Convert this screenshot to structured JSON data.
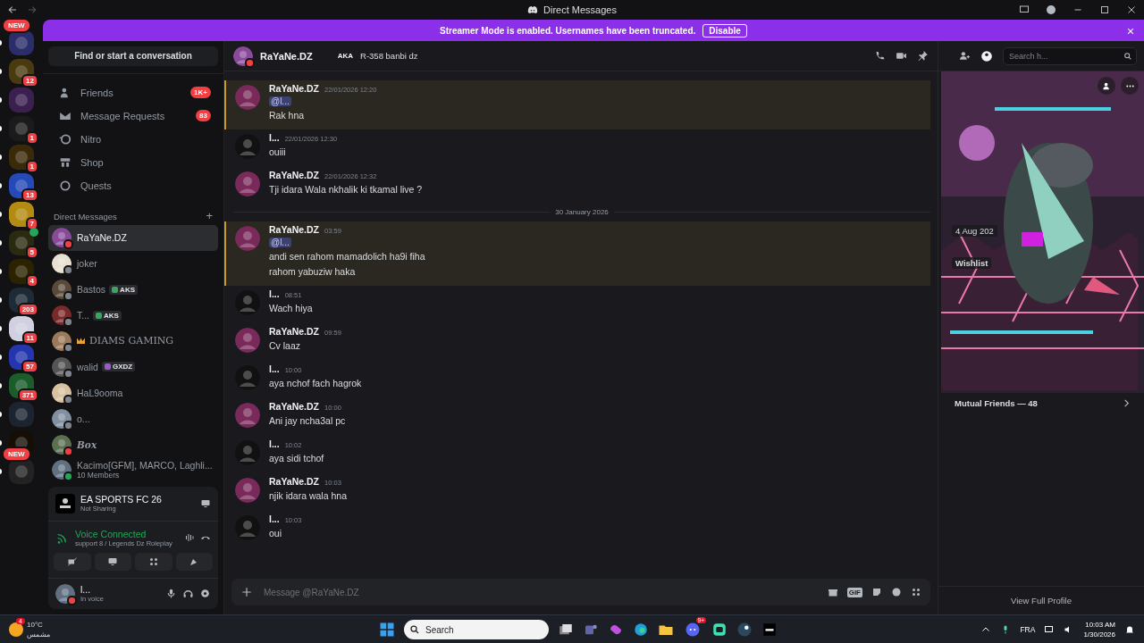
{
  "window": {
    "title": "Direct Messages"
  },
  "banner": {
    "text": "Streamer Mode is enabled. Usernames have been truncated.",
    "button": "Disable"
  },
  "servers": [
    {
      "unread": true,
      "new_label": "NEW"
    },
    {
      "unread": true,
      "badge": "12"
    },
    {
      "unread": true
    },
    {
      "unread": true,
      "badge": "1"
    },
    {
      "unread": true,
      "badge": "1"
    },
    {
      "unread": true,
      "badge": "13"
    },
    {
      "unread": true,
      "badge": "7"
    },
    {
      "unread": true,
      "badge": "5",
      "speaking": true
    },
    {
      "unread": true,
      "badge": "4"
    },
    {
      "unread": true,
      "badge": "203"
    },
    {
      "unread": true,
      "badge": "11"
    },
    {
      "unread": true,
      "badge": "57"
    },
    {
      "unread": true,
      "badge": "371"
    },
    {
      "unread": true
    },
    {
      "unread": true
    },
    {
      "unread": true,
      "new_label": "NEW"
    }
  ],
  "sidebar": {
    "search": "Find or start a conversation",
    "nav": [
      {
        "kind": "friends",
        "label": "Friends",
        "badge": "1K+"
      },
      {
        "kind": "requests",
        "label": "Message Requests",
        "badge": "83"
      },
      {
        "kind": "nitro",
        "label": "Nitro"
      },
      {
        "kind": "shop",
        "label": "Shop"
      },
      {
        "kind": "quests",
        "label": "Quests"
      }
    ],
    "dm_header": "Direct Messages",
    "add": "+",
    "dms": [
      {
        "kind": "plain",
        "name": "RaYaNe.DZ",
        "color": "#f23f43",
        "selected": true
      },
      {
        "kind": "plain",
        "name": "joker",
        "color": "#80848e",
        "selected": false
      },
      {
        "kind": "plain",
        "name": "Bastos",
        "color": "#80848e",
        "selected": false,
        "tag": {
          "label": "AKS",
          "color": "#3ba55d"
        }
      },
      {
        "kind": "plain",
        "name": "T...",
        "color": "#80848e",
        "selected": false,
        "tag": {
          "label": "AKS",
          "color": "#3ba55d"
        }
      },
      {
        "kind": "serif",
        "name": "DIAMS GAMING",
        "color": "#80848e",
        "selected": false,
        "crown": true
      },
      {
        "kind": "plain",
        "name": "walid",
        "color": "#80848e",
        "selected": false,
        "tag": {
          "label": "GXDZ",
          "color": "#9b59d0"
        }
      },
      {
        "kind": "plain",
        "name": "HaL9ooma",
        "color": "#80848e",
        "selected": false
      },
      {
        "kind": "plain",
        "name": "o...",
        "color": "#80848e",
        "selected": false
      },
      {
        "kind": "italic",
        "name": "Box",
        "color": "#f23f43",
        "selected": false
      },
      {
        "kind": "plain",
        "name": "Kacimo[GFM], MARCO, Laghli...",
        "subtitle": "10 Members",
        "color": "#23a55a",
        "selected": false
      }
    ]
  },
  "activity": {
    "title": "EA SPORTS FC 26",
    "subtitle": "Not Sharing"
  },
  "voice": {
    "title": "Voice Connected",
    "channel": "support 8 / Legends Dz Roleplay"
  },
  "user": {
    "name": "l...",
    "status": "In voice"
  },
  "chat": {
    "name": "RaYaNe.DZ",
    "aka": "AKA",
    "alias": "R-358 banbi dz",
    "search": {
      "placeholder": "Search h..."
    },
    "messages": [
      {
        "kind": "message",
        "author": "RaYaNe.DZ",
        "time": "22/01/2026 12:20",
        "mention": "@l...",
        "highlighted": true,
        "lines": [
          "Rak hna"
        ]
      },
      {
        "kind": "message",
        "author": "l...",
        "time": "22/01/2026 12:30",
        "highlighted": false,
        "lines": [
          "ouiii"
        ]
      },
      {
        "kind": "message",
        "author": "RaYaNe.DZ",
        "time": "22/01/2026 12:32",
        "highlighted": false,
        "lines": [
          "Tji idara Wala nkhalik ki tkamal live ?"
        ]
      },
      {
        "kind": "divider",
        "label": "30 January 2026"
      },
      {
        "kind": "message",
        "author": "RaYaNe.DZ",
        "time": "03:59",
        "mention": "@l...",
        "highlighted": true,
        "lines": [
          "andi sen rahom mamadolich ha9i fiha",
          "rahom yabuziw haka"
        ]
      },
      {
        "kind": "message",
        "author": "l...",
        "time": "08:51",
        "highlighted": false,
        "lines": [
          "Wach hiya"
        ]
      },
      {
        "kind": "message",
        "author": "RaYaNe.DZ",
        "time": "09:59",
        "highlighted": false,
        "lines": [
          "Cv laaz"
        ]
      },
      {
        "kind": "message",
        "author": "l...",
        "time": "10:00",
        "highlighted": false,
        "lines": [
          "aya nchof fach hagrok"
        ]
      },
      {
        "kind": "message",
        "author": "RaYaNe.DZ",
        "time": "10:00",
        "highlighted": false,
        "lines": [
          "Ani jay ncha3al pc"
        ]
      },
      {
        "kind": "message",
        "author": "l...",
        "time": "10:02",
        "highlighted": false,
        "lines": [
          "aya sidi tchof"
        ]
      },
      {
        "kind": "message",
        "author": "RaYaNe.DZ",
        "time": "10:03",
        "highlighted": false,
        "lines": [
          "njik idara wala hna"
        ]
      },
      {
        "kind": "message",
        "author": "l...",
        "time": "10:03",
        "highlighted": false,
        "lines": [
          "oui"
        ]
      }
    ],
    "composer": {
      "placeholder": "Message @RaYaNe.DZ",
      "gif": "GIF"
    }
  },
  "profile": {
    "kind": "picture",
    "date": "4 Aug 202",
    "wishlist": "Wishlist",
    "mutual_friends": "Mutual Friends — 48",
    "view": "View Full Profile"
  },
  "taskbar": {
    "weather_badge": "4",
    "temperature": "10°C",
    "condition": "مشمس",
    "search": "Search",
    "discord_badge": "9+",
    "language": "FRA",
    "time": "10:03 AM",
    "date": "1/30/2026"
  }
}
